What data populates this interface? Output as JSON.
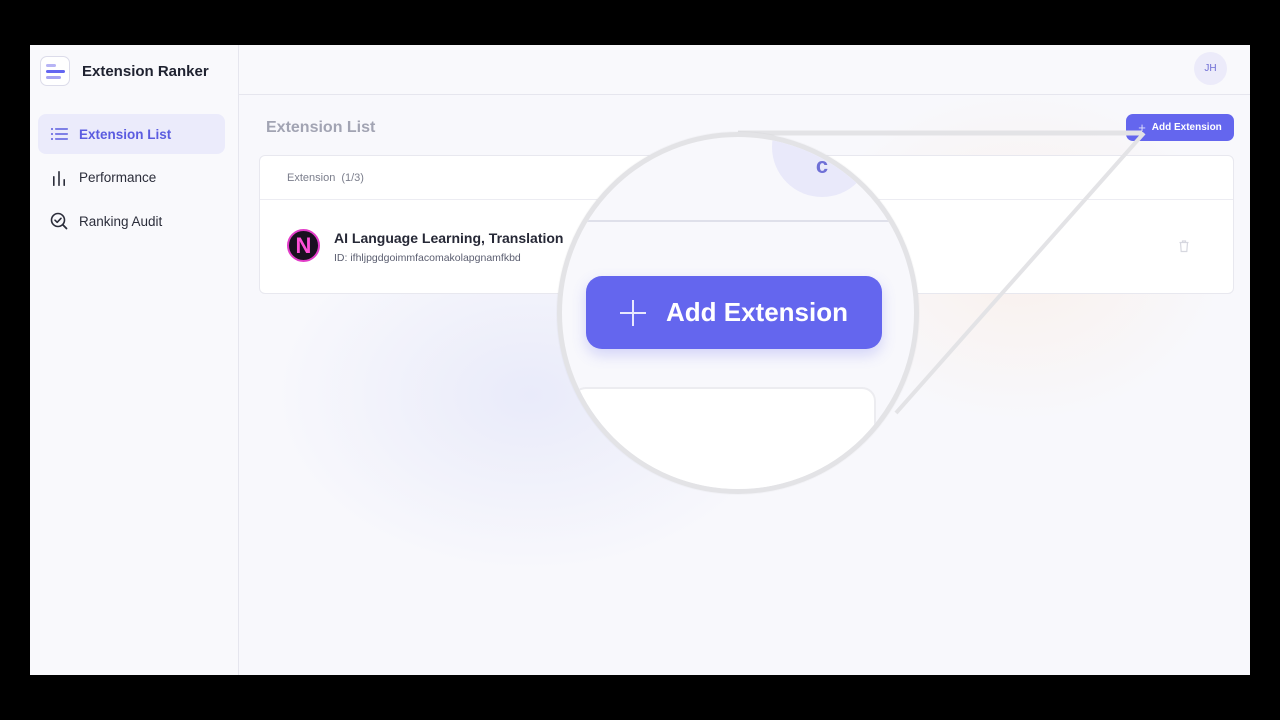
{
  "app": {
    "name": "Extension Ranker"
  },
  "sidebar": {
    "items": [
      {
        "label": "Extension List",
        "icon": "list-icon",
        "active": true
      },
      {
        "label": "Performance",
        "icon": "bar-chart-icon",
        "active": false
      },
      {
        "label": "Ranking Audit",
        "icon": "search-check-icon",
        "active": false
      }
    ]
  },
  "topbar": {
    "avatar_initials": "JH"
  },
  "main": {
    "title": "Extension List",
    "add_button_label": "Add Extension",
    "table": {
      "header_label": "Extension",
      "header_count": "(1/3)",
      "rows": [
        {
          "logo_letter": "N",
          "name": "AI Language Learning, Translation",
          "id": "ID: ifhljpgdgoimmfacomakolapgnamfkbd"
        }
      ]
    }
  },
  "magnifier": {
    "button_label": "Add Extension",
    "partial_glyph": "c"
  },
  "colors": {
    "accent": "#6466ee",
    "active_nav_bg": "#ebebfb",
    "active_nav_text": "#5b5ce0",
    "logo_pink": "#e23cc8"
  }
}
